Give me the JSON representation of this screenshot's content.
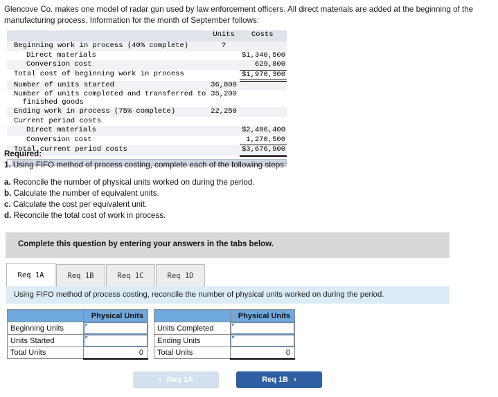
{
  "intro": {
    "paragraph": "Glencove Co. makes one model of radar gun used by law enforcement officers. All direct materials are added at the beginning of the manufacturing process. Information for the month of September follows:"
  },
  "exhibit": {
    "col_units": "Units",
    "col_costs": "Costs",
    "rows": [
      {
        "label": "Beginning work in process (40% complete)",
        "units": "?",
        "costs": "",
        "indent": 0,
        "shade": true
      },
      {
        "label": "Direct materials",
        "units": "",
        "costs": "$1,340,500",
        "indent": 1,
        "shade": false
      },
      {
        "label": "Conversion cost",
        "units": "",
        "costs": "629,800",
        "indent": 1,
        "shade": true,
        "rule": "single"
      },
      {
        "label": "Total cost of beginning work in process",
        "units": "",
        "costs": "$1,970,300",
        "indent": 0,
        "shade": false,
        "rule": "double"
      },
      {
        "label": "Number of units started",
        "units": "36,800",
        "costs": "",
        "indent": 0,
        "shade": true
      },
      {
        "label": "Number of units completed and transferred to\n  finished goods",
        "units": "35,200",
        "costs": "",
        "indent": 0,
        "shade": false
      },
      {
        "label": "Ending work in process (75% complete)",
        "units": "22,250",
        "costs": "",
        "indent": 0,
        "shade": true
      },
      {
        "label": "Current period costs",
        "units": "",
        "costs": "",
        "indent": 0,
        "shade": false
      },
      {
        "label": "Direct materials",
        "units": "",
        "costs": "$2,406,400",
        "indent": 1,
        "shade": true
      },
      {
        "label": "Conversion cost",
        "units": "",
        "costs": "1,270,500",
        "indent": 1,
        "shade": false,
        "rule": "single"
      },
      {
        "label": "Total current period costs",
        "units": "",
        "costs": "$3,676,900",
        "indent": 0,
        "shade": true,
        "rule": "double"
      }
    ]
  },
  "required": {
    "heading": "Required:",
    "item1": "1. Using FIFO method of process costing, complete each of the following steps:",
    "item1_num": "1.",
    "item1_text": " Using FIFO method of process costing, complete each of the following steps:",
    "steps": [
      {
        "marker": "a.",
        "text": " Reconcile the number of physical units worked on during the period."
      },
      {
        "marker": "b.",
        "text": " Calculate the number of equivalent units."
      },
      {
        "marker": "c.",
        "text": " Calculate the cost per equivalent unit."
      },
      {
        "marker": "d.",
        "text": " Reconcile the total cost of work in process."
      }
    ]
  },
  "banner": {
    "text": "Complete this question by entering your answers in the tabs below."
  },
  "tabs": {
    "items": [
      {
        "label": "Req 1A",
        "active": true
      },
      {
        "label": "Req 1B",
        "active": false
      },
      {
        "label": "Req 1C",
        "active": false
      },
      {
        "label": "Req 1D",
        "active": false
      }
    ]
  },
  "infobar": {
    "text": "Using FIFO method of process costing, reconcile the number of physical units worked on during the period."
  },
  "answer_grid": {
    "left_header_blank": "",
    "left_header_units": "Physical Units",
    "right_header_blank": "",
    "right_header_units": "Physical Units",
    "left_rows": [
      {
        "label": "Beginning Units",
        "value": "",
        "input": true
      },
      {
        "label": "Units Started",
        "value": "",
        "input": true
      },
      {
        "label": "Total Units",
        "value": "0",
        "input": false
      }
    ],
    "right_rows": [
      {
        "label": "Units Completed",
        "value": "",
        "input": true
      },
      {
        "label": "Ending Units",
        "value": "",
        "input": true
      },
      {
        "label": "Total Units",
        "value": "0",
        "input": false
      }
    ]
  },
  "nav": {
    "prev_label": "Req 1A",
    "prev_chevron": "‹",
    "next_label": "Req 1B",
    "next_chevron": "›"
  },
  "colors": {
    "header_blue": "#6fa8dc",
    "info_blue": "#dcebf6",
    "banner_grey": "#d8d8d8",
    "next_button": "#2e5fa3",
    "prev_button": "#d3e0f0"
  }
}
